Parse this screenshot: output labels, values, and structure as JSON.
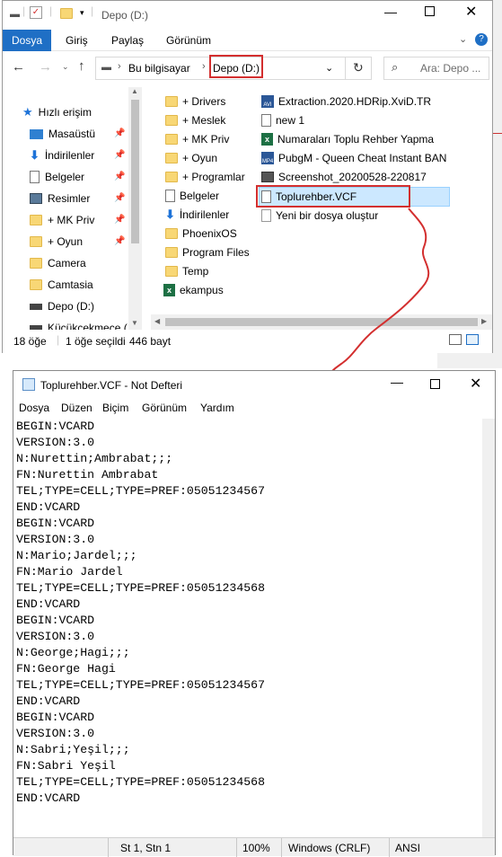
{
  "explorer": {
    "title": "Depo (D:)",
    "ribbon_tabs": [
      "Dosya",
      "Giriş",
      "Paylaş",
      "Görünüm"
    ],
    "address": {
      "root": "Bu bilgisayar",
      "current": "Depo (D:)"
    },
    "search_placeholder": "Ara: Depo ...",
    "nav_items": [
      {
        "label": "Hızlı erişim",
        "icon": "star-icon"
      },
      {
        "label": "Masaüstü",
        "icon": "desktop-icon",
        "pinned": true
      },
      {
        "label": "İndirilenler",
        "icon": "download-icon",
        "pinned": true
      },
      {
        "label": "Belgeler",
        "icon": "document-icon",
        "pinned": true
      },
      {
        "label": "Resimler",
        "icon": "pictures-icon",
        "pinned": true
      },
      {
        "label": "+ MK Priv",
        "icon": "folder-icon",
        "pinned": true
      },
      {
        "label": "+ Oyun",
        "icon": "folder-icon",
        "pinned": true
      },
      {
        "label": "Camera",
        "icon": "folder-icon"
      },
      {
        "label": "Camtasia",
        "icon": "folder-icon"
      },
      {
        "label": "Depo (D:)",
        "icon": "drive-icon"
      },
      {
        "label": "Küçükçekmece (",
        "icon": "drive-icon"
      }
    ],
    "files_col1": [
      {
        "name": "+ Drivers",
        "icon": "folder-icon"
      },
      {
        "name": "+ Meslek",
        "icon": "folder-icon"
      },
      {
        "name": "+ MK Priv",
        "icon": "folder-icon"
      },
      {
        "name": "+ Oyun",
        "icon": "folder-icon"
      },
      {
        "name": "+ Programlar",
        "icon": "folder-icon"
      },
      {
        "name": "Belgeler",
        "icon": "document-icon"
      },
      {
        "name": "İndirilenler",
        "icon": "download-icon"
      },
      {
        "name": "PhoenixOS",
        "icon": "folder-icon"
      },
      {
        "name": "Program Files",
        "icon": "folder-icon"
      },
      {
        "name": "Temp",
        "icon": "folder-icon"
      },
      {
        "name": "ekampus",
        "icon": "excel-icon"
      }
    ],
    "files_col2": [
      {
        "name": "Extraction.2020.HDRip.XviD.TR",
        "icon": "video-icon"
      },
      {
        "name": "new 1",
        "icon": "file-icon"
      },
      {
        "name": "Numaraları Toplu Rehber Yapma",
        "icon": "excel-icon"
      },
      {
        "name": "PubgM - Queen Cheat Instant BAN",
        "icon": "video-icon"
      },
      {
        "name": "Screenshot_20200528-220817",
        "icon": "image-icon"
      },
      {
        "name": "Toplurehber.VCF",
        "icon": "file-icon",
        "selected": true
      },
      {
        "name": "Yeni bir dosya oluştur",
        "icon": "text-file-icon"
      }
    ],
    "status": {
      "count": "18 öğe",
      "selected": "1 öğe seçildi",
      "size": "446 bayt"
    }
  },
  "notepad": {
    "title": "Toplurehber.VCF - Not Defteri",
    "menu": [
      "Dosya",
      "Düzen",
      "Biçim",
      "Görünüm",
      "Yardım"
    ],
    "lines": [
      "BEGIN:VCARD",
      "VERSION:3.0",
      "N:Nurettin;Ambrabat;;;",
      "FN:Nurettin Ambrabat",
      "TEL;TYPE=CELL;TYPE=PREF:05051234567",
      "END:VCARD",
      "BEGIN:VCARD",
      "VERSION:3.0",
      "N:Mario;Jardel;;;",
      "FN:Mario Jardel",
      "TEL;TYPE=CELL;TYPE=PREF:05051234568",
      "END:VCARD",
      "BEGIN:VCARD",
      "VERSION:3.0",
      "N:George;Hagi;;;",
      "FN:George Hagi",
      "TEL;TYPE=CELL;TYPE=PREF:05051234567",
      "END:VCARD",
      "BEGIN:VCARD",
      "VERSION:3.0",
      "N:Sabri;Yeşil;;;",
      "FN:Sabri Yeşil",
      "TEL;TYPE=CELL;TYPE=PREF:05051234568",
      "END:VCARD"
    ],
    "status": {
      "position": "St 1, Stn 1",
      "zoom": "100%",
      "line_ending": "Windows (CRLF)",
      "encoding": "ANSI"
    }
  },
  "colors": {
    "accent": "#1f6fc5",
    "annotation": "#d32f2f"
  }
}
